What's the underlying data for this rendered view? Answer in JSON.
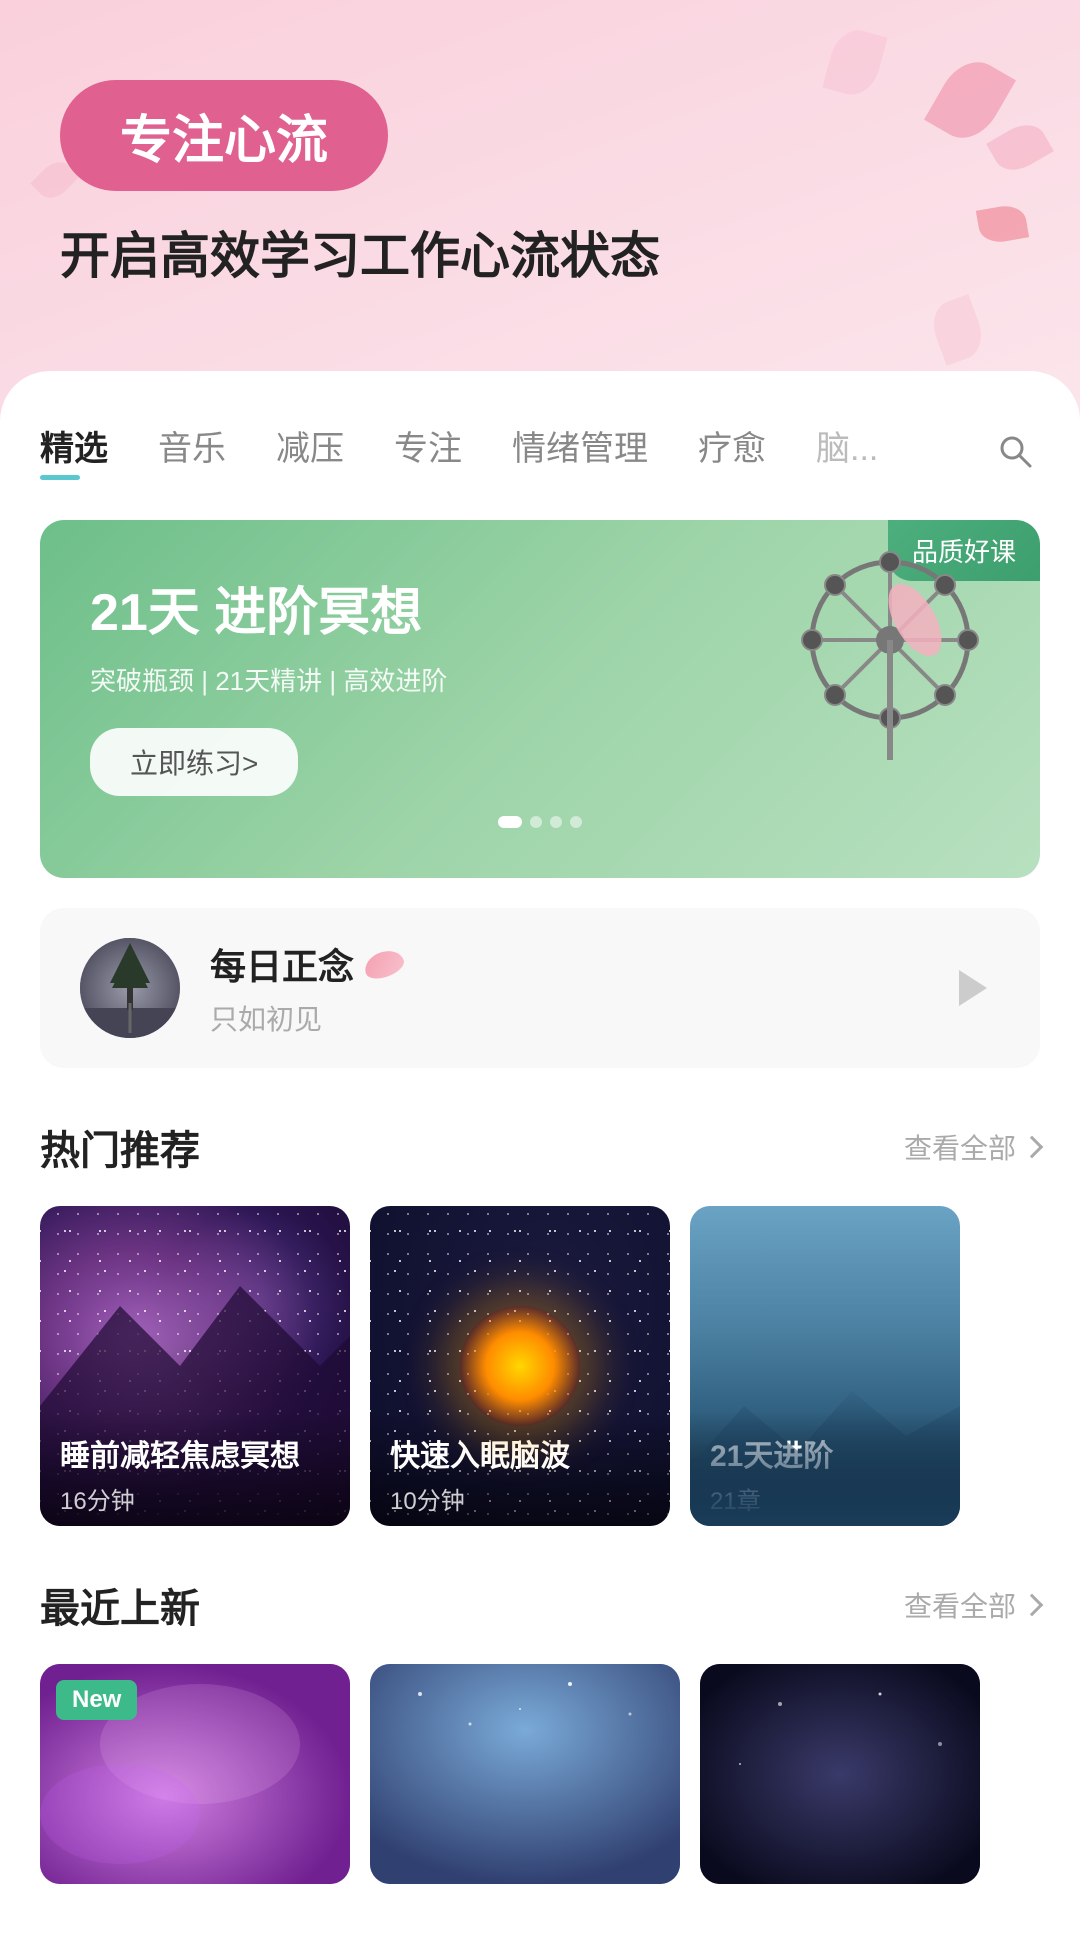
{
  "app": {
    "background_gradient": "linear-gradient(160deg, #f9d0dc, #fce8ee)"
  },
  "hero": {
    "badge": "专注心流",
    "subtitle": "开启高效学习工作心流状态"
  },
  "tabs": {
    "items": [
      {
        "label": "精选",
        "active": true
      },
      {
        "label": "音乐",
        "active": false
      },
      {
        "label": "减压",
        "active": false
      },
      {
        "label": "专注",
        "active": false
      },
      {
        "label": "情绪管理",
        "active": false
      },
      {
        "label": "疗愈",
        "active": false
      },
      {
        "label": "脑...",
        "active": false
      }
    ],
    "search_aria": "搜索"
  },
  "banner": {
    "quality_badge": "品质好课",
    "title": "21天 进阶冥想",
    "tags": "突破瓶颈 | 21天精讲 | 高效进阶",
    "button": "立即练习>",
    "dots": [
      1,
      2,
      3,
      4
    ],
    "active_dot": 1
  },
  "daily_mindful": {
    "title": "每日正念",
    "subtitle": "只如初见",
    "play_aria": "播放"
  },
  "hot_section": {
    "title": "热门推荐",
    "more_label": "查看全部",
    "cards": [
      {
        "name": "睡前减轻焦虑冥想",
        "meta": "16分钟",
        "style": "galaxy-1"
      },
      {
        "name": "快速入眠脑波",
        "meta": "10分钟",
        "style": "galaxy-2"
      },
      {
        "name": "21天进阶",
        "meta": "21章",
        "style": "galaxy-3"
      }
    ]
  },
  "new_section": {
    "title": "最近上新",
    "more_label": "查看全部",
    "cards": [
      {
        "badge": "New",
        "style": "purple"
      },
      {
        "badge": "",
        "style": "blue"
      },
      {
        "badge": "",
        "style": "dark"
      }
    ]
  }
}
